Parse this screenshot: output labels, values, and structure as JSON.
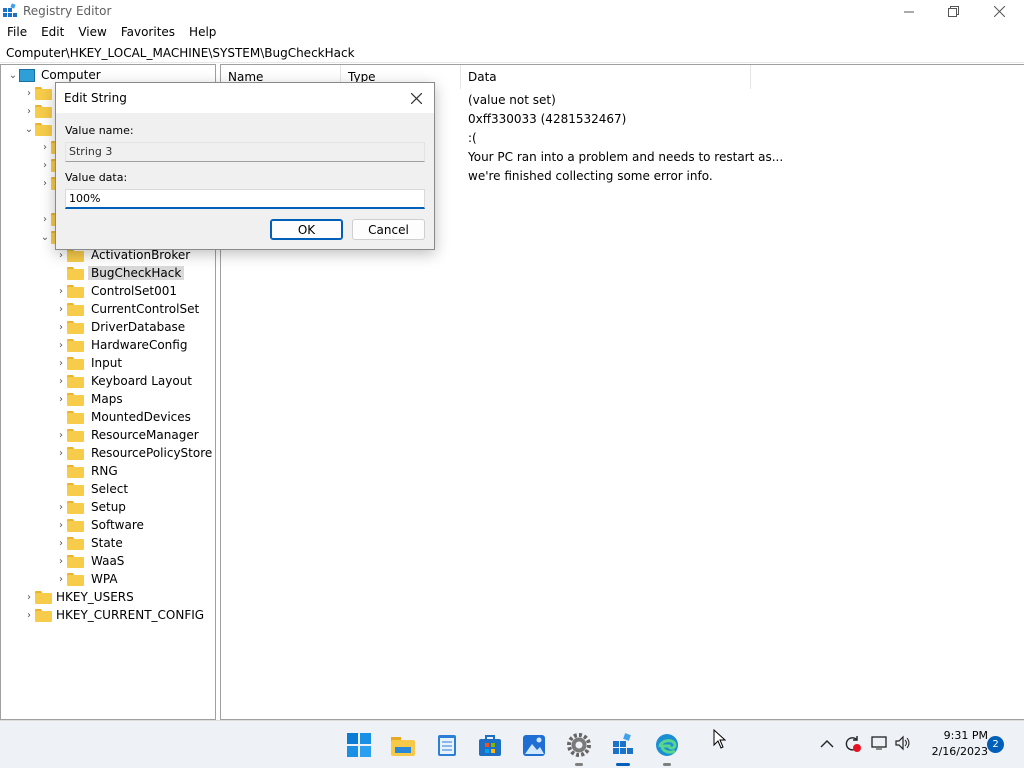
{
  "window": {
    "title": "Registry Editor",
    "minimize_icon": "minimize-icon",
    "maximize_icon": "maximize-icon",
    "close_icon": "close-icon"
  },
  "menu": [
    "File",
    "Edit",
    "View",
    "Favorites",
    "Help"
  ],
  "address": "Computer\\HKEY_LOCAL_MACHINE\\SYSTEM\\BugCheckHack",
  "tree": {
    "root": "Computer",
    "system_children": [
      {
        "label": "ActivationBroker",
        "has_children": true
      },
      {
        "label": "BugCheckHack",
        "has_children": false,
        "selected": true
      },
      {
        "label": "ControlSet001",
        "has_children": true
      },
      {
        "label": "CurrentControlSet",
        "has_children": true
      },
      {
        "label": "DriverDatabase",
        "has_children": true
      },
      {
        "label": "HardwareConfig",
        "has_children": true
      },
      {
        "label": "Input",
        "has_children": true
      },
      {
        "label": "Keyboard Layout",
        "has_children": true
      },
      {
        "label": "Maps",
        "has_children": true
      },
      {
        "label": "MountedDevices",
        "has_children": false
      },
      {
        "label": "ResourceManager",
        "has_children": true
      },
      {
        "label": "ResourcePolicyStore",
        "has_children": true
      },
      {
        "label": "RNG",
        "has_children": false
      },
      {
        "label": "Select",
        "has_children": false
      },
      {
        "label": "Setup",
        "has_children": true
      },
      {
        "label": "Software",
        "has_children": true
      },
      {
        "label": "State",
        "has_children": true
      },
      {
        "label": "WaaS",
        "has_children": true
      },
      {
        "label": "WPA",
        "has_children": true
      }
    ],
    "roots_after": [
      "HKEY_USERS",
      "HKEY_CURRENT_CONFIG"
    ]
  },
  "values": {
    "columns": [
      "Name",
      "Type",
      "Data"
    ],
    "data": [
      "(value not set)",
      "0xff330033 (4281532467)",
      ":(",
      "Your PC  ran into a problem and needs to restart as...",
      "we're finished collecting some error info."
    ]
  },
  "dialog": {
    "title": "Edit String",
    "name_label": "Value name:",
    "name_value": "String 3",
    "data_label": "Value data:",
    "data_value": "100%",
    "ok_label": "OK",
    "cancel_label": "Cancel"
  },
  "taskbar": {
    "apps": [
      "start-icon",
      "file-explorer-icon",
      "notepad-icon",
      "store-icon",
      "photos-icon",
      "settings-icon",
      "registry-editor-icon",
      "edge-icon"
    ],
    "time": "9:31 PM",
    "date": "2/16/2023",
    "notification_count": "2"
  },
  "colors": {
    "accent": "#005fb8",
    "folder": "#f7cc4a",
    "selection": "#d9d9d9"
  }
}
